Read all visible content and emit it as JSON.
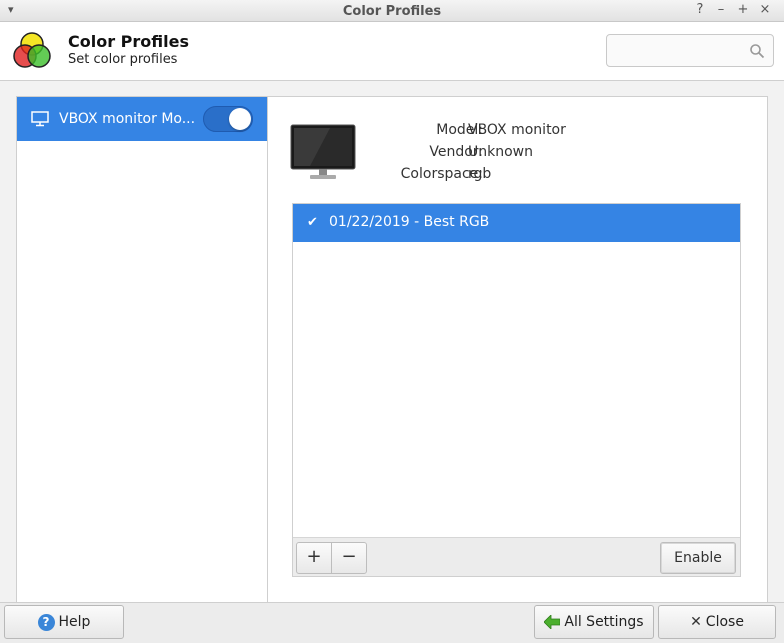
{
  "window": {
    "title": "Color Profiles",
    "menu_glyph": "▾",
    "buttons": {
      "help": "?",
      "minimize": "–",
      "maximize": "+",
      "close": "×"
    }
  },
  "header": {
    "title": "Color Profiles",
    "subtitle": "Set color profiles",
    "search": {
      "value": "",
      "placeholder": ""
    },
    "icon": "color-profiles-app-icon"
  },
  "sidebar": {
    "items": [
      {
        "label": "VBOX monitor Mo...",
        "icon": "monitor-icon",
        "enabled": true,
        "selected": true
      }
    ]
  },
  "device": {
    "fields": [
      {
        "label": "Model:",
        "value": "VBOX monitor"
      },
      {
        "label": "Vendor:",
        "value": "Unknown"
      },
      {
        "label": "Colorspace:",
        "value": "rgb"
      }
    ]
  },
  "profiles": {
    "items": [
      {
        "label": "01/22/2019 - Best RGB",
        "checked": true,
        "check_glyph": "✔"
      }
    ],
    "add_label": "+",
    "remove_label": "−",
    "enable_label": "Enable"
  },
  "footer": {
    "help_label": "Help",
    "help_glyph": "?",
    "all_settings_label": "All Settings",
    "close_label": "Close",
    "close_glyph": "✕"
  },
  "colors": {
    "selection": "#3584e4",
    "header_bg": "#ffffff",
    "window_bg": "#f2f2f2"
  }
}
